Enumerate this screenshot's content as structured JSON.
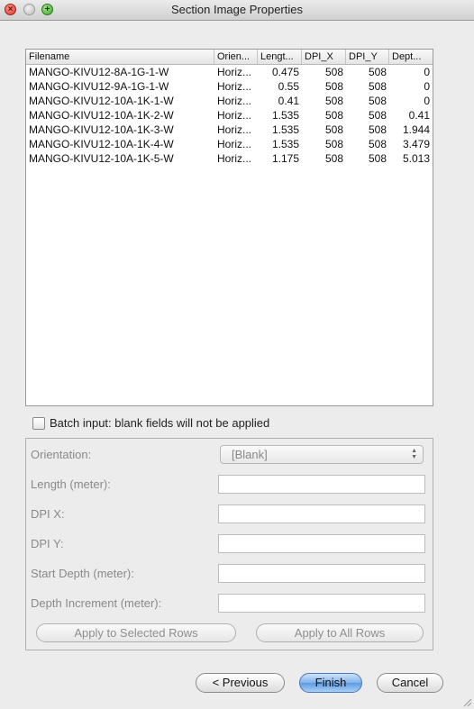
{
  "window": {
    "title": "Section Image Properties"
  },
  "table": {
    "columns": [
      "Filename",
      "Orien...",
      "Lengt...",
      "DPI_X",
      "DPI_Y",
      "Dept..."
    ],
    "rows": [
      {
        "filename": "MANGO-KIVU12-8A-1G-1-W",
        "orientation": "Horiz...",
        "length": "0.475",
        "dpi_x": "508",
        "dpi_y": "508",
        "depth": "0"
      },
      {
        "filename": "MANGO-KIVU12-9A-1G-1-W",
        "orientation": "Horiz...",
        "length": "0.55",
        "dpi_x": "508",
        "dpi_y": "508",
        "depth": "0"
      },
      {
        "filename": "MANGO-KIVU12-10A-1K-1-W",
        "orientation": "Horiz...",
        "length": "0.41",
        "dpi_x": "508",
        "dpi_y": "508",
        "depth": "0"
      },
      {
        "filename": "MANGO-KIVU12-10A-1K-2-W",
        "orientation": "Horiz...",
        "length": "1.535",
        "dpi_x": "508",
        "dpi_y": "508",
        "depth": "0.41"
      },
      {
        "filename": "MANGO-KIVU12-10A-1K-3-W",
        "orientation": "Horiz...",
        "length": "1.535",
        "dpi_x": "508",
        "dpi_y": "508",
        "depth": "1.944"
      },
      {
        "filename": "MANGO-KIVU12-10A-1K-4-W",
        "orientation": "Horiz...",
        "length": "1.535",
        "dpi_x": "508",
        "dpi_y": "508",
        "depth": "3.479"
      },
      {
        "filename": "MANGO-KIVU12-10A-1K-5-W",
        "orientation": "Horiz...",
        "length": "1.175",
        "dpi_x": "508",
        "dpi_y": "508",
        "depth": "5.013"
      }
    ]
  },
  "batch": {
    "label": "Batch input: blank fields will not be applied",
    "checked": false
  },
  "form": {
    "orientation_label": "Orientation:",
    "orientation_value": "[Blank]",
    "length_label": "Length (meter):",
    "dpi_x_label": "DPI X:",
    "dpi_y_label": "DPI Y:",
    "start_depth_label": "Start Depth (meter):",
    "depth_increment_label": "Depth Increment (meter):",
    "apply_selected": "Apply to Selected Rows",
    "apply_all": "Apply to All Rows"
  },
  "footer": {
    "previous": "< Previous",
    "finish": "Finish",
    "cancel": "Cancel"
  },
  "icons": {
    "close": "close-icon",
    "minimize": "minimize-icon",
    "zoom": "zoom-icon",
    "select_arrows": "updown-arrows-icon",
    "resize": "resize-grip-icon"
  }
}
